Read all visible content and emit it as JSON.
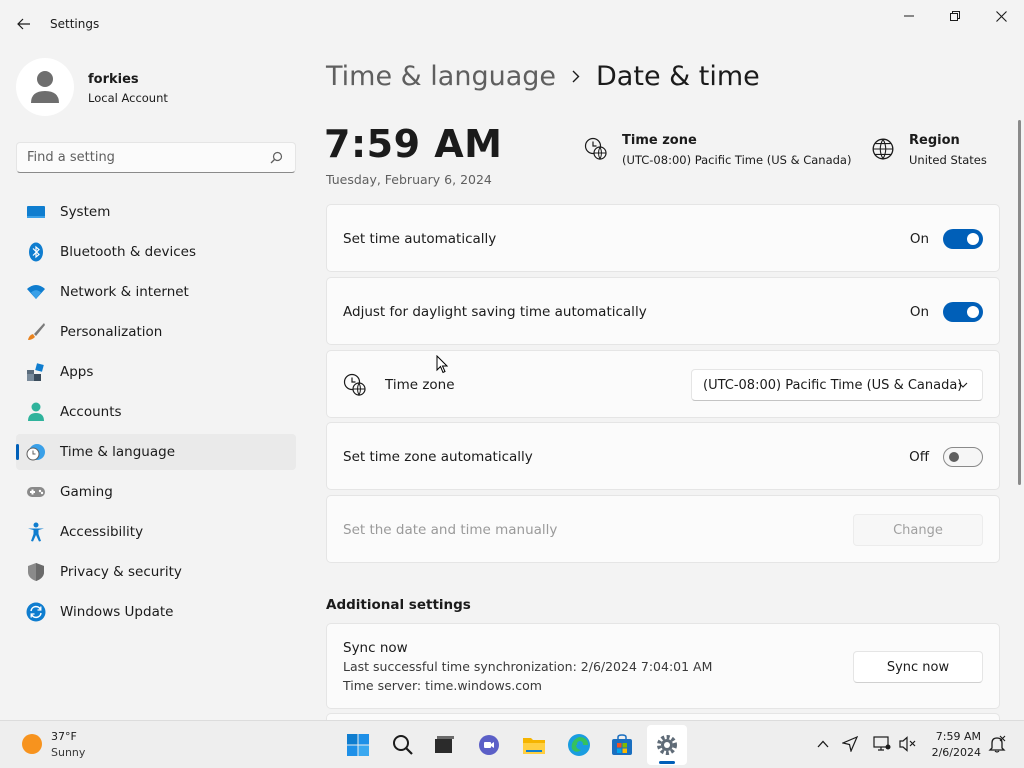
{
  "window": {
    "title": "Settings"
  },
  "profile": {
    "name": "forkies",
    "account_type": "Local Account"
  },
  "search": {
    "placeholder": "Find a setting"
  },
  "sidebar": {
    "items": [
      {
        "label": "System",
        "icon": "monitor-icon",
        "selected": false
      },
      {
        "label": "Bluetooth & devices",
        "icon": "bluetooth-icon",
        "selected": false
      },
      {
        "label": "Network & internet",
        "icon": "wifi-icon",
        "selected": false
      },
      {
        "label": "Personalization",
        "icon": "paintbrush-icon",
        "selected": false
      },
      {
        "label": "Apps",
        "icon": "apps-icon",
        "selected": false
      },
      {
        "label": "Accounts",
        "icon": "person-icon",
        "selected": false
      },
      {
        "label": "Time & language",
        "icon": "clock-globe-icon",
        "selected": true
      },
      {
        "label": "Gaming",
        "icon": "gamepad-icon",
        "selected": false
      },
      {
        "label": "Accessibility",
        "icon": "accessibility-icon",
        "selected": false
      },
      {
        "label": "Privacy & security",
        "icon": "shield-icon",
        "selected": false
      },
      {
        "label": "Windows Update",
        "icon": "update-icon",
        "selected": false
      }
    ]
  },
  "breadcrumb": {
    "parent": "Time & language",
    "current": "Date & time"
  },
  "clock": {
    "time": "7:59 AM",
    "date": "Tuesday, February 6, 2024"
  },
  "header_info": {
    "timezone_title": "Time zone",
    "timezone_value": "(UTC-08:00) Pacific Time (US & Canada)",
    "region_title": "Region",
    "region_value": "United States"
  },
  "settings": {
    "set_time_auto": {
      "label": "Set time automatically",
      "state": "On"
    },
    "daylight_saving": {
      "label": "Adjust for daylight saving time automatically",
      "state": "On"
    },
    "time_zone": {
      "label": "Time zone",
      "selected": "(UTC-08:00) Pacific Time (US & Canada)"
    },
    "set_tz_auto": {
      "label": "Set time zone automatically",
      "state": "Off"
    },
    "manual": {
      "label": "Set the date and time manually",
      "button": "Change"
    }
  },
  "additional": {
    "title": "Additional settings",
    "sync": {
      "title": "Sync now",
      "last_sync": "Last successful time synchronization: 2/6/2024 7:04:01 AM",
      "server": "Time server: time.windows.com",
      "button": "Sync now"
    }
  },
  "taskbar": {
    "weather_temp": "37°F",
    "weather_cond": "Sunny",
    "time": "7:59 AM",
    "date": "2/6/2024"
  },
  "colors": {
    "accent": "#005fb8",
    "background": "#f3f3f3",
    "card": "#fbfbfb"
  }
}
